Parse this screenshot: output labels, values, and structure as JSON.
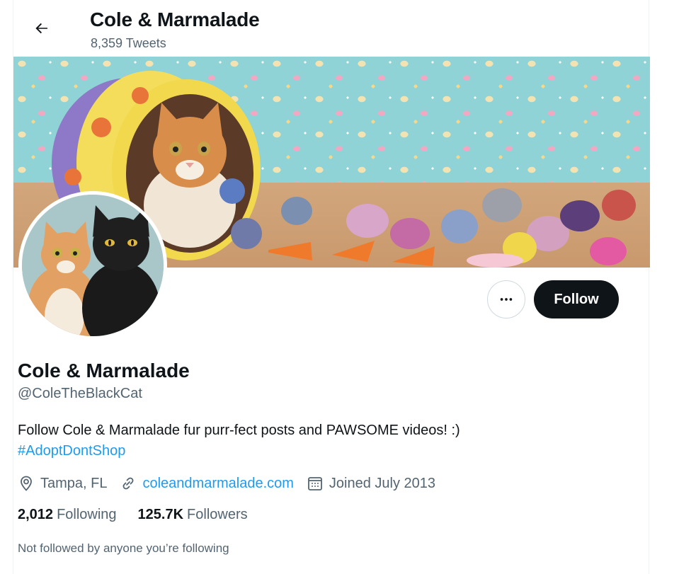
{
  "header": {
    "title": "Cole & Marmalade",
    "tweet_count": "8,359 Tweets",
    "back_icon": "arrow-left-icon"
  },
  "profile": {
    "display_name": "Cole & Marmalade",
    "handle": "@ColeTheBlackCat",
    "bio_text": "Follow Cole & Marmalade fur purr-fect posts and PAWSOME videos! :)",
    "bio_hashtag": "#AdoptDontShop",
    "location": "Tampa, FL",
    "website": "coleandmarmalade.com",
    "joined": "Joined July 2013",
    "following_count": "2,012",
    "following_label": "Following",
    "followers_count": "125.7K",
    "followers_label": "Followers",
    "mutuals_note": "Not followed by anyone you’re following"
  },
  "actions": {
    "more_icon": "more-horizontal-icon",
    "follow_label": "Follow"
  },
  "colors": {
    "accent": "#1d9bf0",
    "text": "#0f1419",
    "muted": "#536471",
    "follow_bg": "#0f1419"
  }
}
